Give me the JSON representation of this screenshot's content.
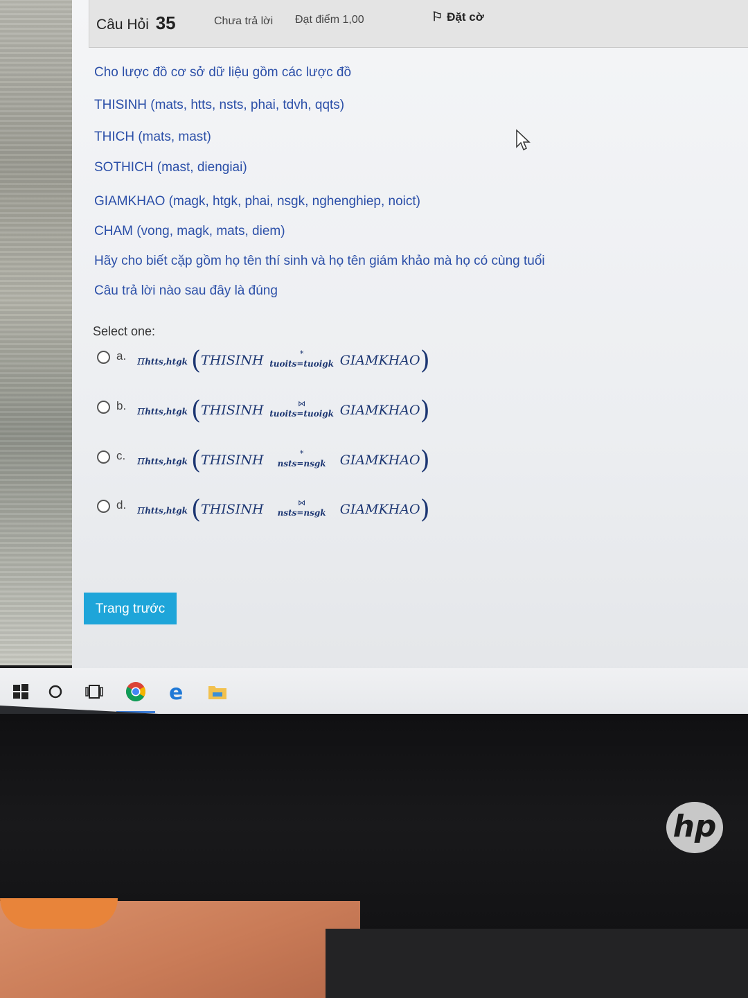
{
  "question": {
    "label": "Câu Hỏi",
    "number": "35",
    "status": "Chưa trả lời",
    "points": "Đạt điểm 1,00",
    "flag_label": "Đặt cờ"
  },
  "question_text": [
    "Cho lược đồ cơ sở dữ liệu gồm các lược đồ",
    "THISINH (mats, htts, nsts, phai, tdvh, qqts)",
    "THICH (mats, mast)",
    "SOTHICH (mast, diengiai)",
    "GIAMKHAO (magk, htgk, phai, nsgk, nghenghiep, noict)",
    "CHAM (vong, magk, mats, diem)",
    "Hãy cho biết cặp gồm họ tên thí sinh và họ tên giám khảo mà họ có cùng tuổi",
    "Câu trả lời nào sau đây là đúng"
  ],
  "select_label": "Select one:",
  "options": [
    {
      "letter": "a.",
      "pi": "π",
      "pi_sub": "htts,htgk",
      "left": "THISINH",
      "op": "*",
      "cond": "tuoits=tuoigk",
      "right": "GIAMKHAO"
    },
    {
      "letter": "b.",
      "pi": "π",
      "pi_sub": "htts,htgk",
      "left": "THISINH",
      "op": "⋈",
      "cond": "tuoits=tuoigk",
      "right": "GIAMKHAO"
    },
    {
      "letter": "c.",
      "pi": "π",
      "pi_sub": "htts,htgk",
      "left": "THISINH",
      "op": "*",
      "cond": "nsts=nsgk",
      "right": "GIAMKHAO"
    },
    {
      "letter": "d.",
      "pi": "π",
      "pi_sub": "htts,htgk",
      "left": "THISINH",
      "op": "⋈",
      "cond": "nsts=nsgk",
      "right": "GIAMKHAO"
    }
  ],
  "prev_button": "Trang trước",
  "taskbar": {
    "icons": [
      "windows-start-icon",
      "search-circle-icon",
      "task-view-icon",
      "chrome-icon",
      "edge-icon",
      "file-explorer-icon"
    ]
  },
  "brand": "hp"
}
